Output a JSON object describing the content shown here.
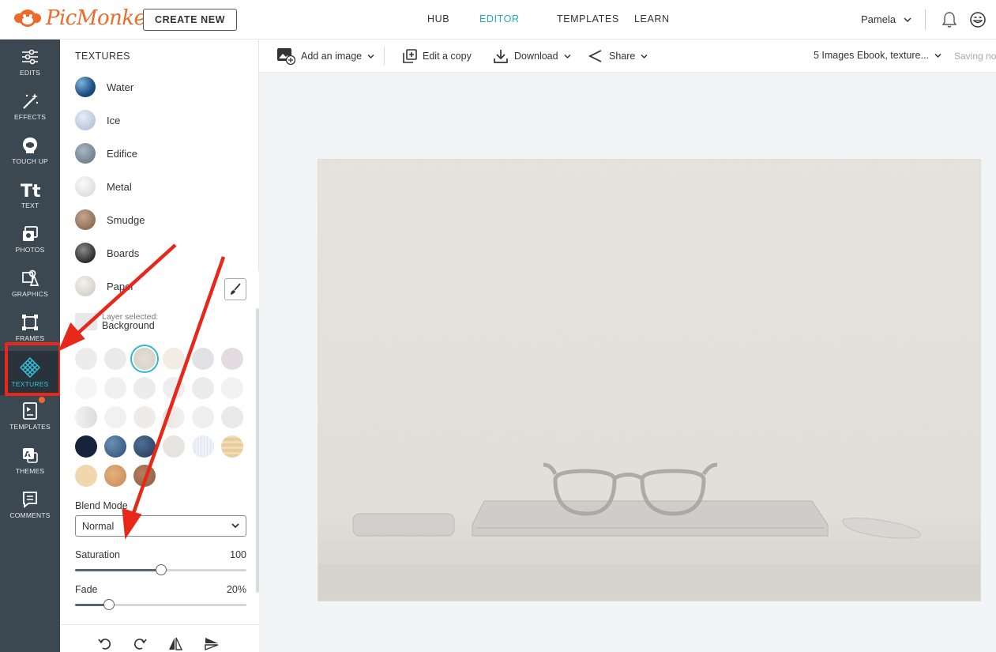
{
  "app": {
    "brand": "PicMonkey",
    "create_new": "CREATE NEW",
    "nav": [
      "HUB",
      "EDITOR",
      "TEMPLATES",
      "LEARN"
    ],
    "active_nav": "EDITOR",
    "user": "Pamela",
    "accent": "#20a9c1",
    "brand_color": "#ee6a2a"
  },
  "rail": {
    "items": [
      {
        "label": "EDITS",
        "icon": "sliders-icon"
      },
      {
        "label": "EFFECTS",
        "icon": "magic-wand-icon"
      },
      {
        "label": "TOUCH UP",
        "icon": "face-icon"
      },
      {
        "label": "TEXT",
        "icon": "text-icon"
      },
      {
        "label": "PHOTOS",
        "icon": "photos-icon"
      },
      {
        "label": "GRAPHICS",
        "icon": "graphics-icon"
      },
      {
        "label": "FRAMES",
        "icon": "frame-icon"
      },
      {
        "label": "TEXTURES",
        "icon": "texture-icon"
      },
      {
        "label": "TEMPLATES",
        "icon": "template-icon"
      },
      {
        "label": "THEMES",
        "icon": "themes-icon"
      },
      {
        "label": "COMMENTS",
        "icon": "comment-icon"
      }
    ],
    "active": "TEXTURES"
  },
  "panel": {
    "title": "TEXTURES",
    "textures": [
      "Water",
      "Ice",
      "Edifice",
      "Metal",
      "Smudge",
      "Boards",
      "Paper"
    ],
    "layer_selected_label": "Layer selected:",
    "layer_name": "Background",
    "blend_mode_label": "Blend Mode",
    "blend_mode_value": "Normal",
    "saturation_label": "Saturation",
    "saturation_value": "100",
    "saturation_level": 0.5,
    "fade_label": "Fade",
    "fade_value": "20%",
    "fade_level": 0.2
  },
  "toolbar": {
    "add_image": "Add an image",
    "edit_copy": "Edit a copy",
    "download": "Download",
    "share": "Share",
    "doc_title": "5 Images Ebook, texture...",
    "saving": "Saving now"
  }
}
